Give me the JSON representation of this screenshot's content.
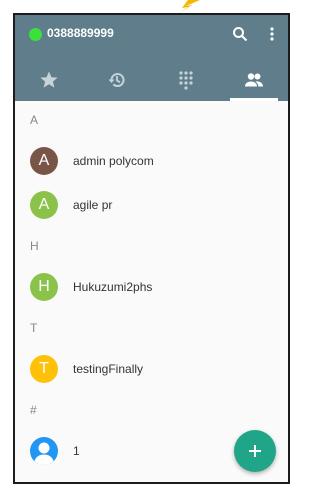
{
  "status": {
    "phone_number": "0388889999",
    "presence_color": "#3be03b"
  },
  "toolbar": {
    "icons": [
      "search-icon",
      "more-vert-icon"
    ]
  },
  "tabs": [
    {
      "icon": "star-icon",
      "active": false
    },
    {
      "icon": "history-icon",
      "active": false
    },
    {
      "icon": "dialpad-icon",
      "active": false
    },
    {
      "icon": "contacts-icon",
      "active": true
    }
  ],
  "sections": [
    {
      "letter": "A",
      "contacts": [
        {
          "initial": "A",
          "name": "admin polycom",
          "color": "#795548"
        },
        {
          "initial": "A",
          "name": "agile pr",
          "color": "#8bc34a"
        }
      ]
    },
    {
      "letter": "H",
      "contacts": [
        {
          "initial": "H",
          "name": "Hukuzumi2phs",
          "color": "#8bc34a"
        }
      ]
    },
    {
      "letter": "T",
      "contacts": [
        {
          "initial": "T",
          "name": "testingFinally",
          "color": "#ffc107"
        }
      ]
    },
    {
      "letter": "#",
      "contacts": [
        {
          "initial": "",
          "name": "1",
          "color": "#2196f3",
          "icon": "person-icon"
        }
      ]
    }
  ],
  "fab": {
    "label": "+",
    "color": "#21a588"
  }
}
